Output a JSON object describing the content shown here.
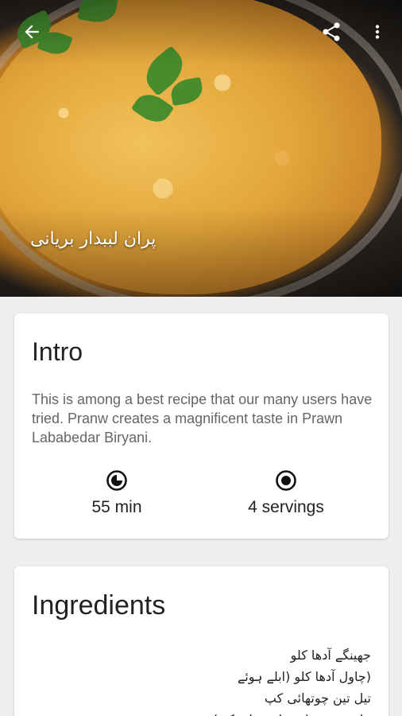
{
  "app": {
    "recipe_title": "پران لببدار بریانی"
  },
  "appbar": {
    "back_icon": "arrow-back-icon",
    "share_icon": "share-icon",
    "more_icon": "more-vert-icon"
  },
  "intro": {
    "heading": "Intro",
    "description": "This is among a best recipe that our many users have tried. Pranw creates a magnificent taste in Prawn Lababedar Biryani.",
    "time": "55 min",
    "time_icon": "timer-icon",
    "servings": "4 servings",
    "servings_icon": "servings-icon"
  },
  "ingredients": {
    "heading": "Ingredients",
    "items": [
      "جھینگے آدھا کلو",
      "(چاول آدھا کلو (ابلے ہوئے",
      "تیل تین چوتھائی کپ",
      "پیاز دو عدد (درمیانے سائز کی)"
    ]
  },
  "colors": {
    "background": "#efefef",
    "card": "#ffffff",
    "text_primary": "#222222",
    "text_secondary": "#666666"
  }
}
